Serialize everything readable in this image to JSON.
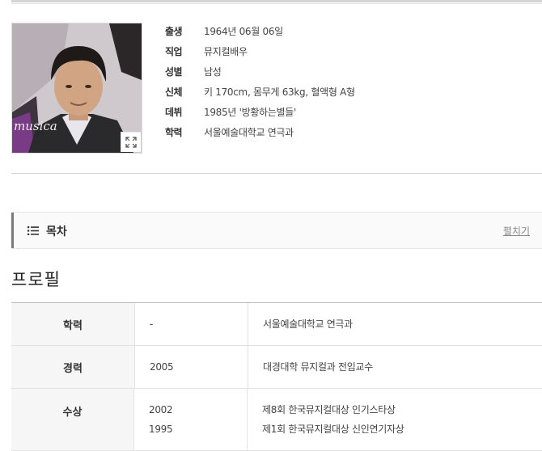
{
  "profile": {
    "rows": [
      {
        "label": "출생",
        "value": "1964년 06월 06일"
      },
      {
        "label": "직업",
        "value": "뮤지컬배우"
      },
      {
        "label": "성별",
        "value": "남성"
      },
      {
        "label": "신체",
        "value": "키 170cm, 몸무게 63kg, 혈액형 A형"
      },
      {
        "label": "데뷔",
        "value": "1985년 '방황하는별들'"
      },
      {
        "label": "학력",
        "value": "서울예술대학교 연극과"
      }
    ],
    "photo_caption": "musica"
  },
  "toc": {
    "icon": "list-icon",
    "title": "목차",
    "toggle_label": "펼치기"
  },
  "section": {
    "title": "프로필"
  },
  "table": {
    "rows": [
      {
        "head": "학력",
        "entries": [
          {
            "year": "-",
            "desc": "서울예술대학교 연극과"
          }
        ]
      },
      {
        "head": "경력",
        "entries": [
          {
            "year": "2005",
            "desc": "대경대학 뮤지컬과 전임교수"
          }
        ]
      },
      {
        "head": "수상",
        "entries": [
          {
            "year": "2002",
            "desc": "제8회 한국뮤지컬대상 인기스타상"
          },
          {
            "year": "1995",
            "desc": "제1회 한국뮤지컬대상 신인연기자상"
          }
        ]
      }
    ]
  }
}
